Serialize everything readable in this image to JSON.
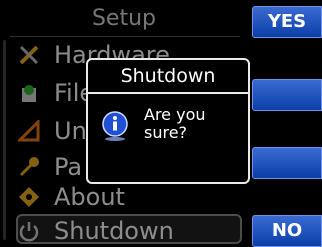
{
  "menu": {
    "title": "Setup",
    "items": [
      {
        "label": "Hardware",
        "icon": "tools-icon"
      },
      {
        "label": "Files",
        "icon": "files-icon"
      },
      {
        "label": "Units",
        "icon": "units-icon"
      },
      {
        "label": "Pa",
        "icon": "key-icon"
      },
      {
        "label": "About",
        "icon": "about-icon"
      },
      {
        "label": "Shutdown",
        "icon": "power-icon",
        "selected": true
      }
    ]
  },
  "softkeys": {
    "top_label": "YES",
    "second_label": "",
    "third_label": "",
    "bottom_label": "NO"
  },
  "dialog": {
    "title": "Shutdown",
    "message": "Are you\nsure?",
    "icon": "info-icon"
  },
  "colors": {
    "softkey_blue": "#1a4fbf",
    "background": "#000000",
    "dialog_border": "#eaeaea"
  }
}
